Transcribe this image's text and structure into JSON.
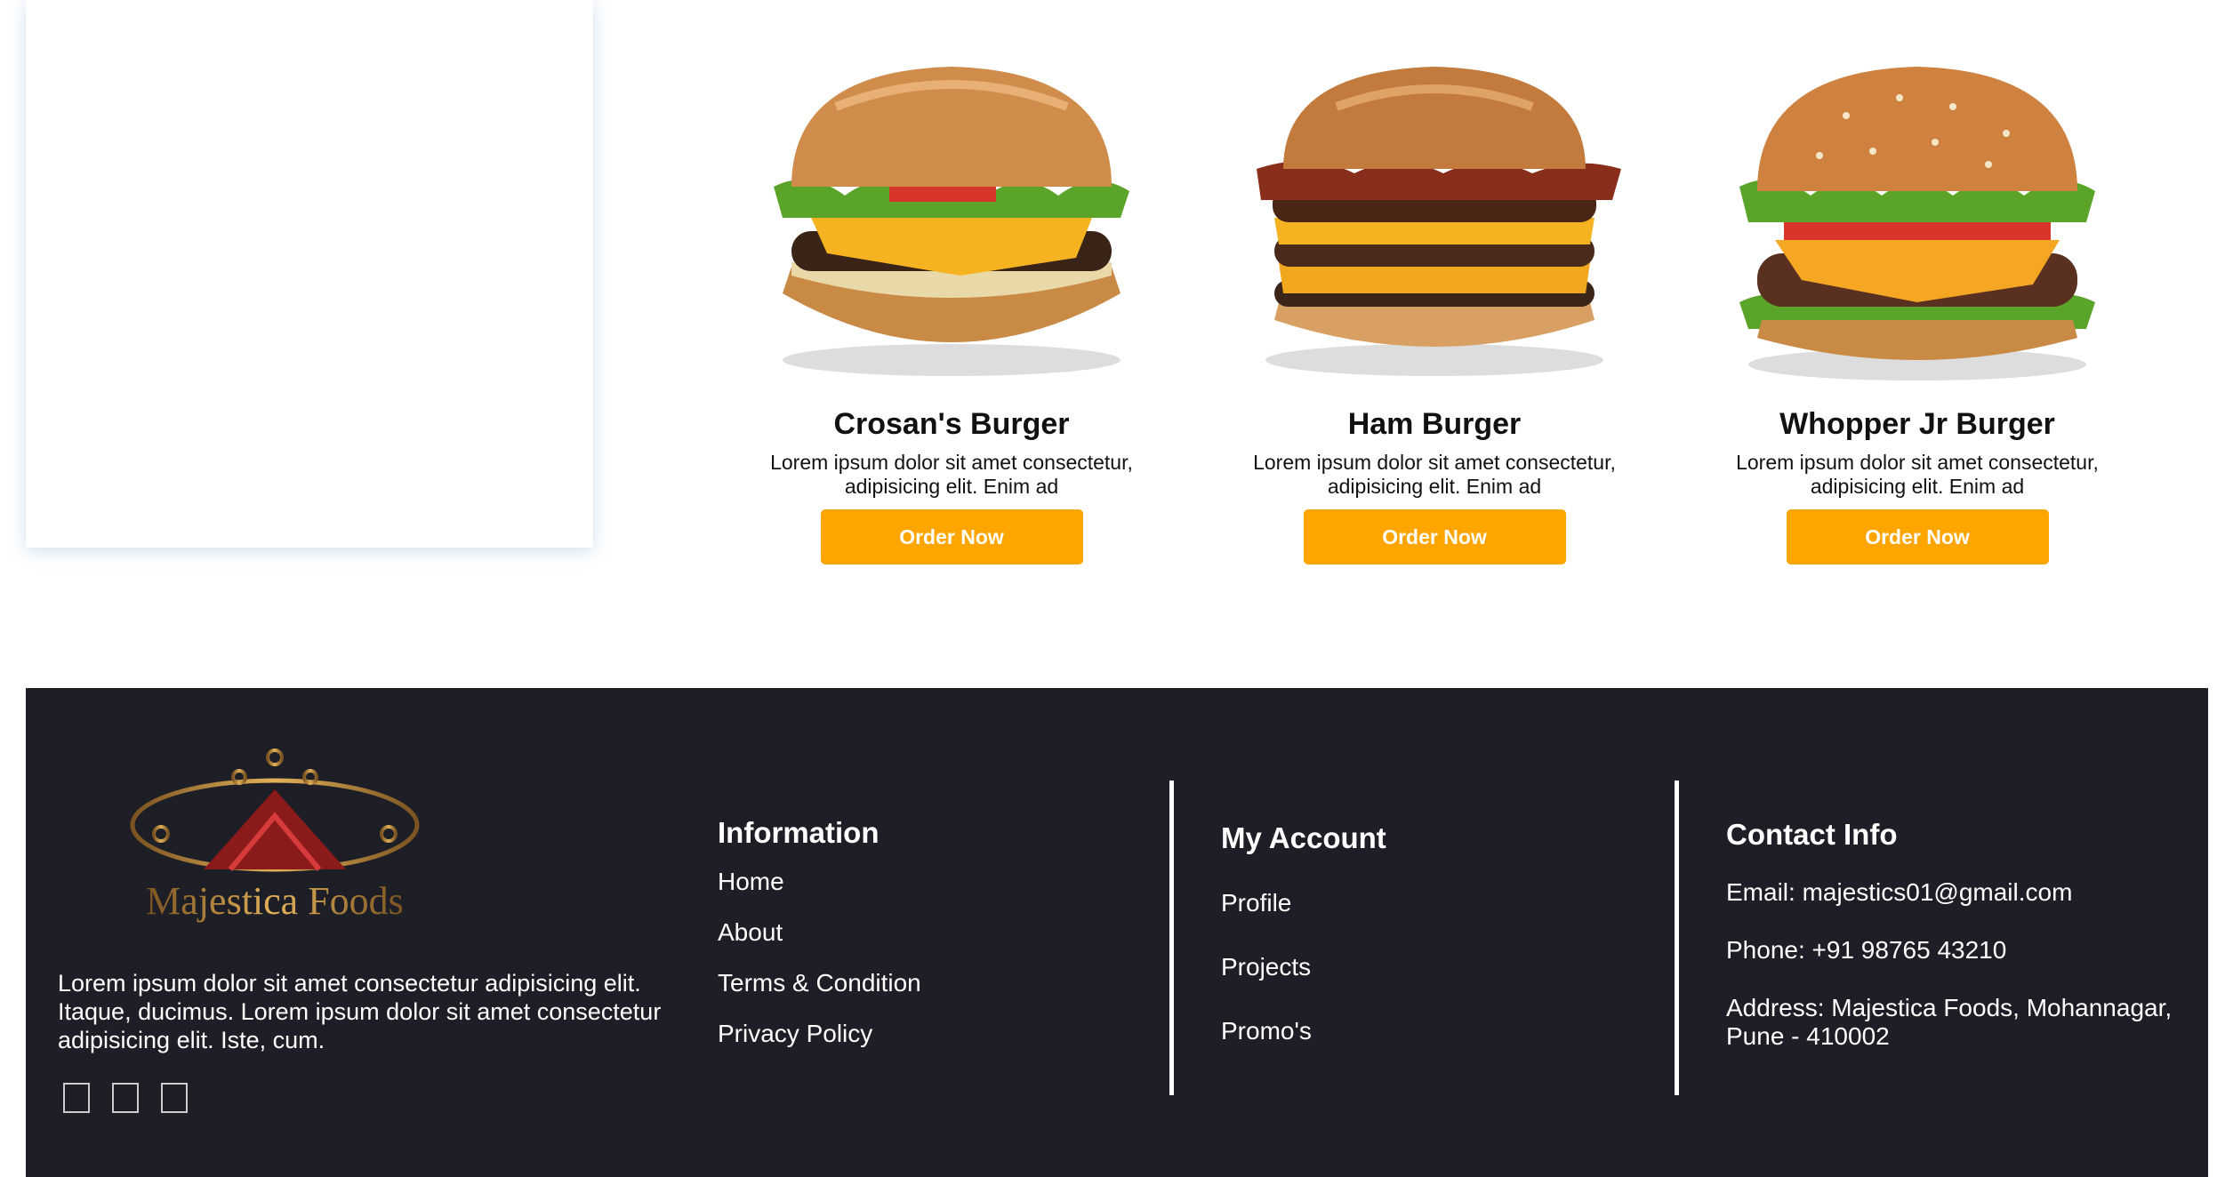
{
  "products": [
    {
      "name": "Crosan's Burger",
      "desc": "Lorem ipsum dolor sit amet consectetur, adipisicing elit. Enim ad",
      "button": "Order Now"
    },
    {
      "name": "Ham Burger",
      "desc": "Lorem ipsum dolor sit amet consectetur, adipisicing elit. Enim ad",
      "button": "Order Now"
    },
    {
      "name": "Whopper Jr Burger",
      "desc": "Lorem ipsum dolor sit amet consectetur, adipisicing elit. Enim ad",
      "button": "Order Now"
    }
  ],
  "footer": {
    "brand": "Majestica Foods",
    "about": "Lorem ipsum dolor sit amet consectetur adipisicing elit. Itaque, ducimus. Lorem ipsum dolor sit amet consectetur adipisicing elit. Iste, cum.",
    "information": {
      "title": "Information",
      "links": [
        "Home",
        "About",
        "Terms & Condition",
        "Privacy Policy"
      ]
    },
    "account": {
      "title": "My Account",
      "links": [
        "Profile",
        "Projects",
        "Promo's"
      ]
    },
    "contact": {
      "title": "Contact Info",
      "email": "Email: majestics01@gmail.com",
      "phone": "Phone: +91 98765 43210",
      "address": "Address: Majestica Foods, Mohannagar, Pune - 410002"
    }
  },
  "colors": {
    "accent": "#ffa500",
    "footer_bg": "#1e1e26"
  }
}
